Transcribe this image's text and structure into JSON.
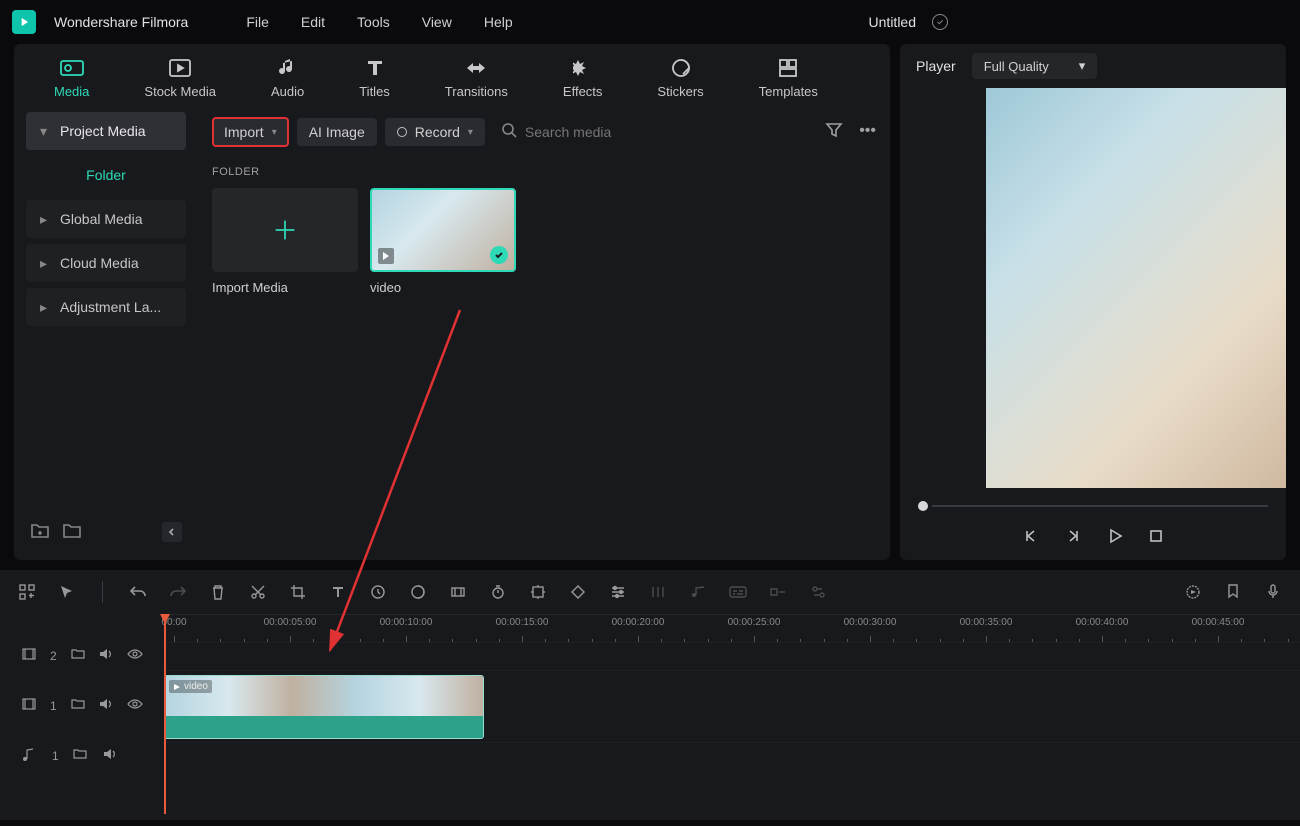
{
  "app": {
    "name": "Wondershare Filmora"
  },
  "menubar": [
    "File",
    "Edit",
    "Tools",
    "View",
    "Help"
  ],
  "project": {
    "title": "Untitled"
  },
  "tabs": [
    {
      "label": "Media",
      "active": true
    },
    {
      "label": "Stock Media"
    },
    {
      "label": "Audio"
    },
    {
      "label": "Titles"
    },
    {
      "label": "Transitions"
    },
    {
      "label": "Effects"
    },
    {
      "label": "Stickers"
    },
    {
      "label": "Templates"
    }
  ],
  "sidebar": {
    "items": [
      {
        "label": "Project Media",
        "active": true
      },
      {
        "label": "Folder",
        "folder": true
      },
      {
        "label": "Global Media"
      },
      {
        "label": "Cloud Media"
      },
      {
        "label": "Adjustment La..."
      }
    ]
  },
  "toolbar": {
    "import": "Import",
    "ai_image": "AI Image",
    "record": "Record",
    "search_placeholder": "Search media"
  },
  "content": {
    "folder_label": "FOLDER",
    "import_media": "Import Media",
    "video_name": "video"
  },
  "player": {
    "title": "Player",
    "quality": "Full Quality"
  },
  "timeline": {
    "tracks": {
      "video2": "2",
      "video1": "1",
      "audio1": "1"
    },
    "clip_name": "video",
    "ruler": [
      "00:00",
      "00:00:05:00",
      "00:00:10:00",
      "00:00:15:00",
      "00:00:20:00",
      "00:00:25:00",
      "00:00:30:00",
      "00:00:35:00",
      "00:00:40:00",
      "00:00:45:00"
    ]
  }
}
